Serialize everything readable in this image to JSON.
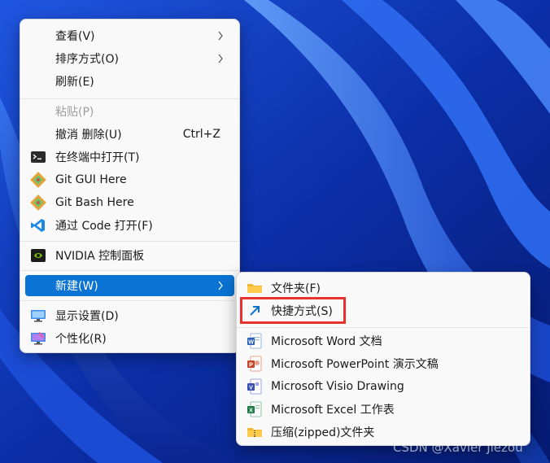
{
  "main_menu": {
    "items": [
      {
        "label": "查看(V)",
        "has_submenu": true
      },
      {
        "label": "排序方式(O)",
        "has_submenu": true
      },
      {
        "label": "刷新(E)"
      },
      {
        "label": "粘贴(P)",
        "disabled": true
      },
      {
        "label": "撤消 删除(U)",
        "shortcut": "Ctrl+Z"
      },
      {
        "label": "在终端中打开(T)",
        "icon": "terminal-icon"
      },
      {
        "label": "Git GUI Here",
        "icon": "git-icon"
      },
      {
        "label": "Git Bash Here",
        "icon": "git-icon"
      },
      {
        "label": "通过 Code 打开(F)",
        "icon": "vscode-icon"
      },
      {
        "label": "NVIDIA 控制面板",
        "icon": "nvidia-icon"
      },
      {
        "label": "新建(W)",
        "has_submenu": true,
        "highlighted": true
      },
      {
        "label": "显示设置(D)",
        "icon": "display-settings-icon"
      },
      {
        "label": "个性化(R)",
        "icon": "personalize-icon"
      }
    ]
  },
  "sub_menu": {
    "items": [
      {
        "label": "文件夹(F)",
        "icon": "folder-icon"
      },
      {
        "label": "快捷方式(S)",
        "icon": "shortcut-arrow-icon",
        "annotated": true
      },
      {
        "label": "Microsoft Word 文档",
        "icon": "word-icon"
      },
      {
        "label": "Microsoft PowerPoint 演示文稿",
        "icon": "powerpoint-icon"
      },
      {
        "label": "Microsoft Visio Drawing",
        "icon": "visio-icon"
      },
      {
        "label": "Microsoft Excel 工作表",
        "icon": "excel-icon"
      },
      {
        "label": "压缩(zipped)文件夹",
        "icon": "zip-folder-icon"
      }
    ]
  },
  "watermark": "CSDN @Xavier Jiezou",
  "colors": {
    "highlight": "#0a73d3",
    "annotation_red": "#e8322d",
    "menu_bg": "#f9f9f9",
    "wallpaper": "#0a2a9a"
  }
}
